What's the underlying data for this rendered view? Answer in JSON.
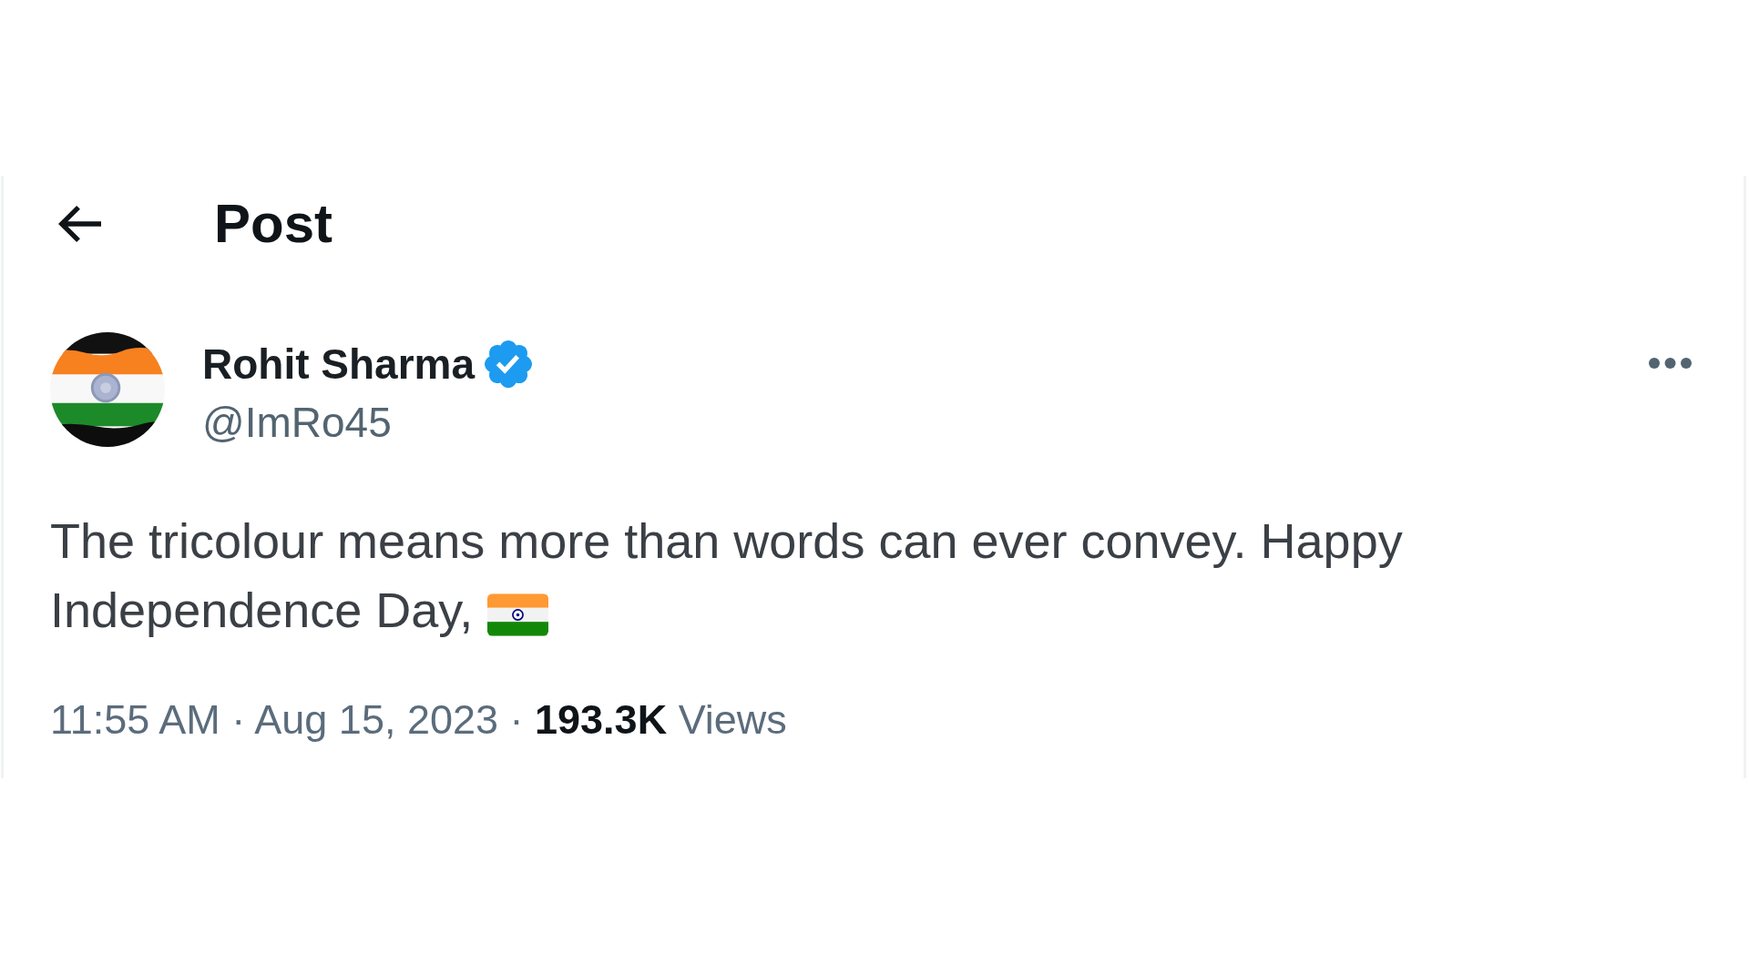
{
  "header": {
    "title": "Post"
  },
  "post": {
    "author": {
      "name": "Rohit Sharma",
      "handle": "@ImRo45",
      "verified": true
    },
    "text_lines": [
      "The tricolour means more than words can ever convey. Happy",
      "Independence Day,"
    ],
    "meta": "11:55 AM · Aug 15, 2023 · **193.3K** Views"
  }
}
